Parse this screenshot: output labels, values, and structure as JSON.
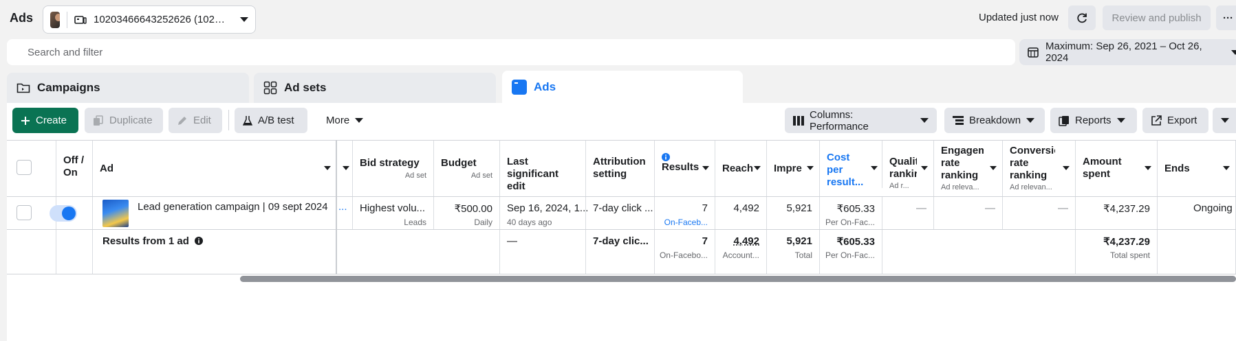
{
  "header": {
    "app_title": "Ads",
    "account_name": "10203466643252626 (102…",
    "updated_text": "Updated just now",
    "review_label": "Review and publish",
    "more_label": "···"
  },
  "search": {
    "placeholder": "Search and filter"
  },
  "date_range": {
    "label": "Maximum: Sep 26, 2021 – Oct 26, 2024"
  },
  "tabs": [
    {
      "label": "Campaigns",
      "icon": "folder-icon"
    },
    {
      "label": "Ad sets",
      "icon": "grid-icon"
    },
    {
      "label": "Ads",
      "icon": "ad-icon",
      "active": true
    }
  ],
  "toolbar": {
    "create": "Create",
    "duplicate": "Duplicate",
    "edit": "Edit",
    "ab_test": "A/B test",
    "more": "More",
    "columns": "Columns: Performance",
    "breakdown": "Breakdown",
    "reports": "Reports",
    "export": "Export"
  },
  "columns": {
    "off_on": "Off / On",
    "ad": "Ad",
    "bid_strategy": "Bid strategy",
    "bid_strategy_sub": "Ad set",
    "budget": "Budget",
    "budget_sub": "Ad set",
    "last_edit": "Last significant edit",
    "attribution": "Attribution setting",
    "results": "Results",
    "reach": "Reach",
    "impressions": "Impre",
    "cost_per_result": "Cost per result...",
    "quality": "Qualit rankir",
    "quality_sub": "Ad r...",
    "engagement": "Engageme rate ranking",
    "engagement_sub": "Ad releva...",
    "conversion": "Conversio rate ranking",
    "conversion_sub": "Ad relevan...",
    "amount_spent": "Amount spent",
    "ends": "Ends"
  },
  "row": {
    "ad_name": "Lead generation campaign | 09 sept 2024",
    "truncated": "...",
    "bid_strategy": "Highest volu...",
    "bid_strategy_sub": "Leads",
    "budget": "₹500.00",
    "budget_sub": "Daily",
    "last_edit": "Sep 16, 2024, 1...",
    "last_edit_sub": "40 days ago",
    "attribution": "7-day click ...",
    "results": "7",
    "results_sub": "On-Faceb...",
    "reach": "4,492",
    "impressions": "5,921",
    "cost_per_result": "₹605.33",
    "cost_per_result_sub": "Per On-Fac...",
    "quality": "—",
    "engagement": "—",
    "conversion": "—",
    "amount_spent": "₹4,237.29",
    "ends": "Ongoing"
  },
  "totals": {
    "label": "Results from 1 ad",
    "last_edit": "—",
    "attribution": "7-day clic...",
    "results": "7",
    "results_sub": "On-Facebo...",
    "reach": "4,492",
    "reach_sub": "Account...",
    "impressions": "5,921",
    "impressions_sub": "Total",
    "cost_per_result": "₹605.33",
    "cost_per_result_sub": "Per On-Fac...",
    "amount_spent": "₹4,237.29",
    "amount_spent_sub": "Total spent"
  },
  "colors": {
    "create_green": "#0a7353",
    "accent_blue": "#1877f2"
  }
}
